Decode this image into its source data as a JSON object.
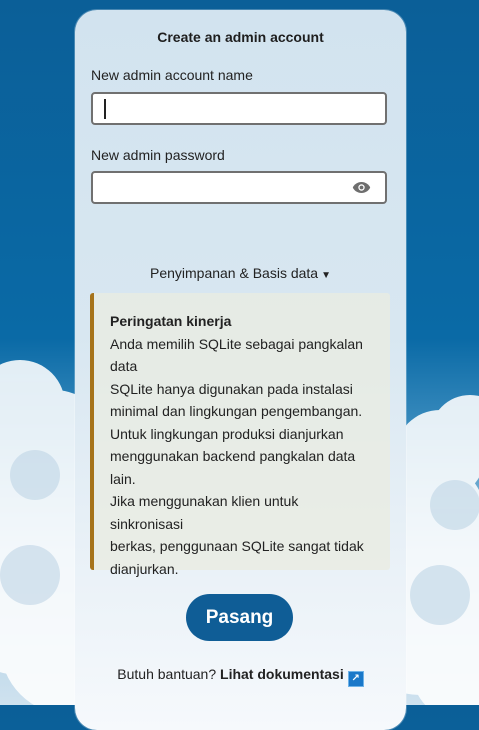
{
  "form": {
    "title": "Create an admin account",
    "username_label": "New admin account name",
    "username_value": "",
    "password_label": "New admin password",
    "password_value": ""
  },
  "storage": {
    "toggle_label": "Penyimpanan & Basis data",
    "toggle_icon": "caret-down-icon"
  },
  "warning": {
    "title": "Peringatan kinerja",
    "lines": [
      "Anda memilih SQLite sebagai pangkalan",
      "data",
      "SQLite hanya digunakan pada instalasi",
      "minimal dan lingkungan pengembangan.",
      "Untuk lingkungan produksi dianjurkan",
      "menggunakan backend pangkalan data",
      "lain.",
      "Jika menggunakan klien untuk sinkronisasi",
      "berkas, penggunaan SQLite sangat tidak",
      "dianjurkan."
    ],
    "accent_color": "#a6731a"
  },
  "install_button": {
    "label": "Pasang",
    "color": "#0f5d96"
  },
  "help": {
    "prefix": "Butuh bantuan?",
    "link_label": "Lihat dokumentasi",
    "link_icon": "external-link-icon",
    "link_icon_glyph": "↗"
  },
  "icons": {
    "password_toggle": "eye-icon"
  }
}
